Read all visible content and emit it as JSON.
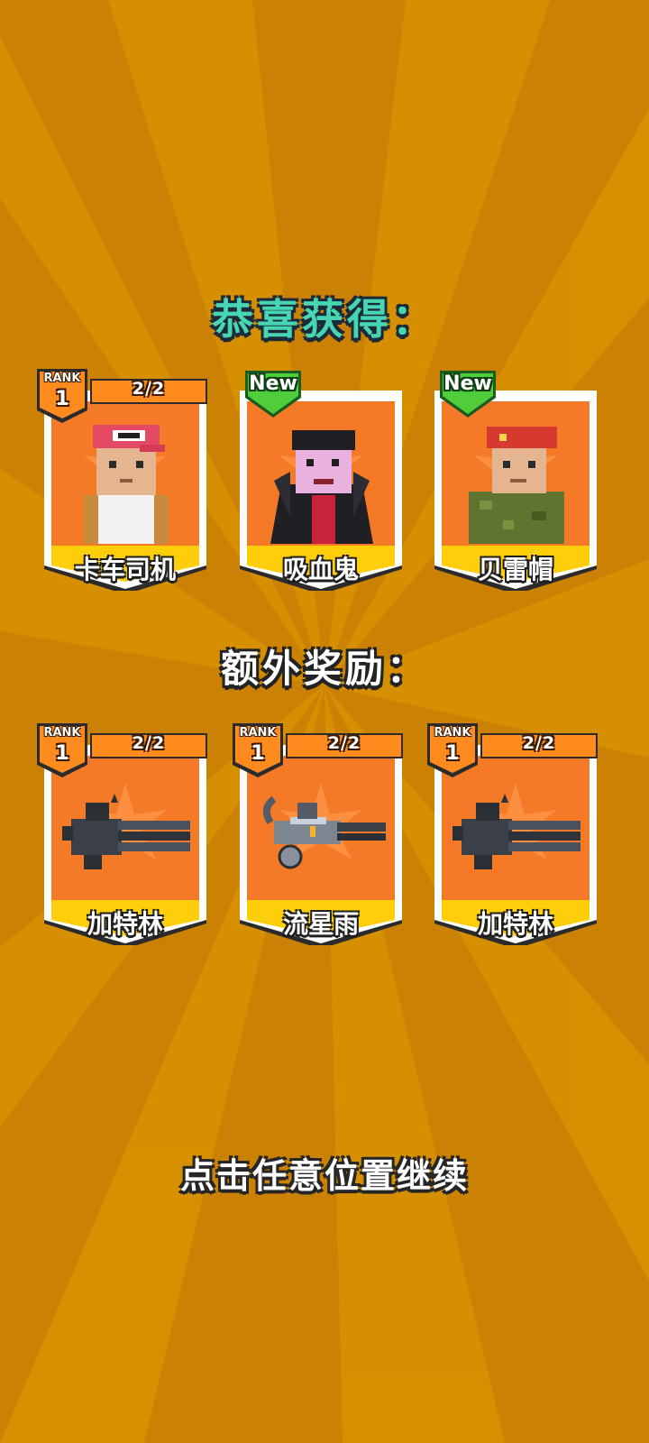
{
  "colors": {
    "background": "#cb8204",
    "background_ray": "#d89100",
    "card_frame": "#ffffff",
    "card_art_bg": "#f57a28",
    "card_name_band": "#ffce0b",
    "rank_badge": "#ff8a1e",
    "count_bar": "#ff8a1e",
    "new_badge": "#4fcd3b",
    "title_text": "#46d7b2"
  },
  "title": "恭喜获得：",
  "bonus_title": "额外奖励：",
  "continue_text": "点击任意位置继续",
  "rewards": [
    {
      "name": "卡车司机",
      "rank_label": "RANK",
      "rank": "1",
      "count": "2/2",
      "icon": "truck-driver-character-icon"
    },
    {
      "name": "吸血鬼",
      "badge": "New",
      "icon": "vampire-character-icon"
    },
    {
      "name": "贝雷帽",
      "badge": "New",
      "icon": "beret-soldier-character-icon"
    }
  ],
  "bonus_rewards": [
    {
      "name": "加特林",
      "rank_label": "RANK",
      "rank": "1",
      "count": "2/2",
      "icon": "gatling-gun-icon"
    },
    {
      "name": "流星雨",
      "rank_label": "RANK",
      "rank": "1",
      "count": "2/2",
      "icon": "meteor-shower-gun-icon"
    },
    {
      "name": "加特林",
      "rank_label": "RANK",
      "rank": "1",
      "count": "2/2",
      "icon": "gatling-gun-icon"
    }
  ]
}
